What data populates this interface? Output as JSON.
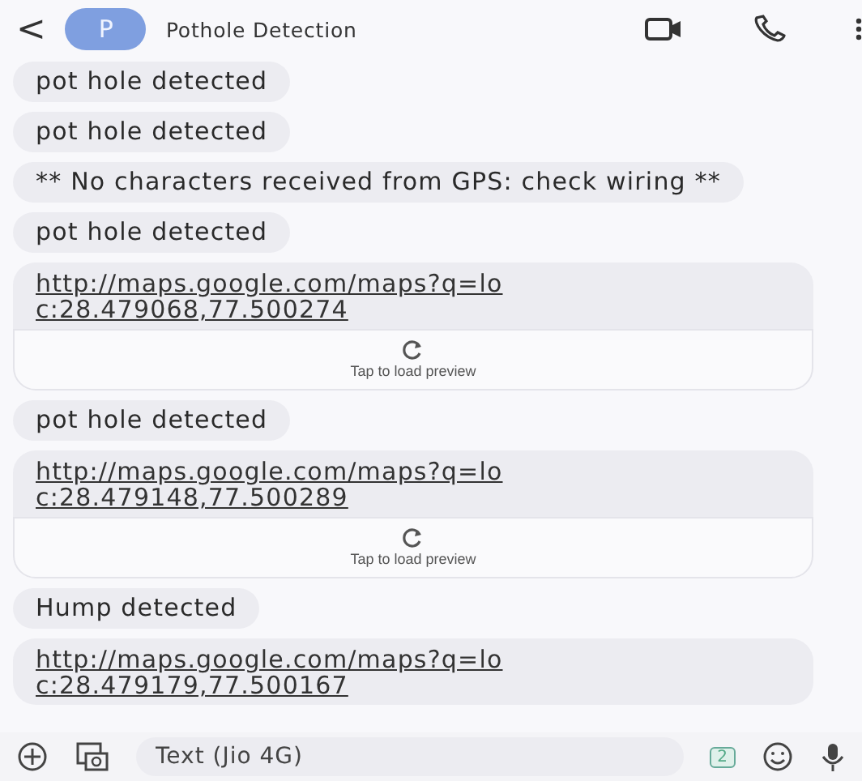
{
  "header": {
    "back": "<",
    "avatar_letter": "P",
    "title": "Pothole Detection"
  },
  "messages": [
    {
      "kind": "text",
      "text": "pot hole detected"
    },
    {
      "kind": "text",
      "text": "pot hole detected"
    },
    {
      "kind": "text",
      "text": "** No characters received from GPS: check wiring **"
    },
    {
      "kind": "text",
      "text": "pot hole detected"
    },
    {
      "kind": "link",
      "text": "http://maps.google.com/maps?q=loc:28.479068,77.500274",
      "preview": "Tap to load preview"
    },
    {
      "kind": "text",
      "text": "pot hole detected"
    },
    {
      "kind": "link",
      "text": "http://maps.google.com/maps?q=loc:28.479148,77.500289",
      "preview": "Tap to load preview"
    },
    {
      "kind": "text",
      "text": "Hump detected"
    },
    {
      "kind": "link",
      "text": "http://maps.google.com/maps?q=loc:28.479179,77.500167"
    }
  ],
  "composer": {
    "placeholder": "Text (Jio 4G)",
    "sim": "2"
  }
}
